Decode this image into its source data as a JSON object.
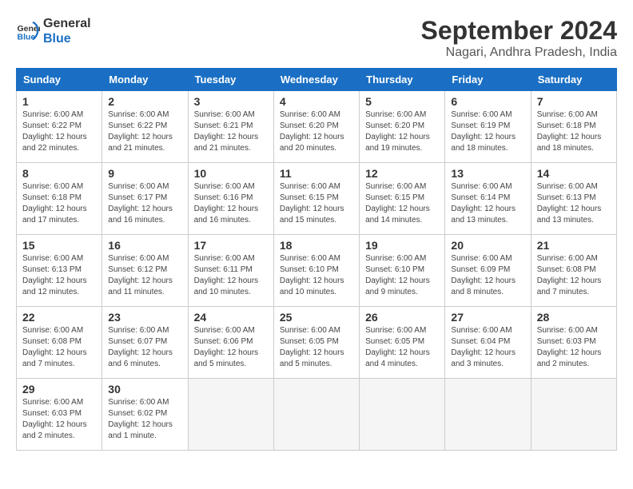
{
  "header": {
    "logo_line1": "General",
    "logo_line2": "Blue",
    "month_year": "September 2024",
    "location": "Nagari, Andhra Pradesh, India"
  },
  "weekdays": [
    "Sunday",
    "Monday",
    "Tuesday",
    "Wednesday",
    "Thursday",
    "Friday",
    "Saturday"
  ],
  "weeks": [
    [
      {
        "day": "1",
        "info": "Sunrise: 6:00 AM\nSunset: 6:22 PM\nDaylight: 12 hours\nand 22 minutes."
      },
      {
        "day": "2",
        "info": "Sunrise: 6:00 AM\nSunset: 6:22 PM\nDaylight: 12 hours\nand 21 minutes."
      },
      {
        "day": "3",
        "info": "Sunrise: 6:00 AM\nSunset: 6:21 PM\nDaylight: 12 hours\nand 21 minutes."
      },
      {
        "day": "4",
        "info": "Sunrise: 6:00 AM\nSunset: 6:20 PM\nDaylight: 12 hours\nand 20 minutes."
      },
      {
        "day": "5",
        "info": "Sunrise: 6:00 AM\nSunset: 6:20 PM\nDaylight: 12 hours\nand 19 minutes."
      },
      {
        "day": "6",
        "info": "Sunrise: 6:00 AM\nSunset: 6:19 PM\nDaylight: 12 hours\nand 18 minutes."
      },
      {
        "day": "7",
        "info": "Sunrise: 6:00 AM\nSunset: 6:18 PM\nDaylight: 12 hours\nand 18 minutes."
      }
    ],
    [
      {
        "day": "8",
        "info": "Sunrise: 6:00 AM\nSunset: 6:18 PM\nDaylight: 12 hours\nand 17 minutes."
      },
      {
        "day": "9",
        "info": "Sunrise: 6:00 AM\nSunset: 6:17 PM\nDaylight: 12 hours\nand 16 minutes."
      },
      {
        "day": "10",
        "info": "Sunrise: 6:00 AM\nSunset: 6:16 PM\nDaylight: 12 hours\nand 16 minutes."
      },
      {
        "day": "11",
        "info": "Sunrise: 6:00 AM\nSunset: 6:15 PM\nDaylight: 12 hours\nand 15 minutes."
      },
      {
        "day": "12",
        "info": "Sunrise: 6:00 AM\nSunset: 6:15 PM\nDaylight: 12 hours\nand 14 minutes."
      },
      {
        "day": "13",
        "info": "Sunrise: 6:00 AM\nSunset: 6:14 PM\nDaylight: 12 hours\nand 13 minutes."
      },
      {
        "day": "14",
        "info": "Sunrise: 6:00 AM\nSunset: 6:13 PM\nDaylight: 12 hours\nand 13 minutes."
      }
    ],
    [
      {
        "day": "15",
        "info": "Sunrise: 6:00 AM\nSunset: 6:13 PM\nDaylight: 12 hours\nand 12 minutes."
      },
      {
        "day": "16",
        "info": "Sunrise: 6:00 AM\nSunset: 6:12 PM\nDaylight: 12 hours\nand 11 minutes."
      },
      {
        "day": "17",
        "info": "Sunrise: 6:00 AM\nSunset: 6:11 PM\nDaylight: 12 hours\nand 10 minutes."
      },
      {
        "day": "18",
        "info": "Sunrise: 6:00 AM\nSunset: 6:10 PM\nDaylight: 12 hours\nand 10 minutes."
      },
      {
        "day": "19",
        "info": "Sunrise: 6:00 AM\nSunset: 6:10 PM\nDaylight: 12 hours\nand 9 minutes."
      },
      {
        "day": "20",
        "info": "Sunrise: 6:00 AM\nSunset: 6:09 PM\nDaylight: 12 hours\nand 8 minutes."
      },
      {
        "day": "21",
        "info": "Sunrise: 6:00 AM\nSunset: 6:08 PM\nDaylight: 12 hours\nand 7 minutes."
      }
    ],
    [
      {
        "day": "22",
        "info": "Sunrise: 6:00 AM\nSunset: 6:08 PM\nDaylight: 12 hours\nand 7 minutes."
      },
      {
        "day": "23",
        "info": "Sunrise: 6:00 AM\nSunset: 6:07 PM\nDaylight: 12 hours\nand 6 minutes."
      },
      {
        "day": "24",
        "info": "Sunrise: 6:00 AM\nSunset: 6:06 PM\nDaylight: 12 hours\nand 5 minutes."
      },
      {
        "day": "25",
        "info": "Sunrise: 6:00 AM\nSunset: 6:05 PM\nDaylight: 12 hours\nand 5 minutes."
      },
      {
        "day": "26",
        "info": "Sunrise: 6:00 AM\nSunset: 6:05 PM\nDaylight: 12 hours\nand 4 minutes."
      },
      {
        "day": "27",
        "info": "Sunrise: 6:00 AM\nSunset: 6:04 PM\nDaylight: 12 hours\nand 3 minutes."
      },
      {
        "day": "28",
        "info": "Sunrise: 6:00 AM\nSunset: 6:03 PM\nDaylight: 12 hours\nand 2 minutes."
      }
    ],
    [
      {
        "day": "29",
        "info": "Sunrise: 6:00 AM\nSunset: 6:03 PM\nDaylight: 12 hours\nand 2 minutes."
      },
      {
        "day": "30",
        "info": "Sunrise: 6:00 AM\nSunset: 6:02 PM\nDaylight: 12 hours\nand 1 minute."
      },
      {
        "day": "",
        "info": ""
      },
      {
        "day": "",
        "info": ""
      },
      {
        "day": "",
        "info": ""
      },
      {
        "day": "",
        "info": ""
      },
      {
        "day": "",
        "info": ""
      }
    ]
  ]
}
